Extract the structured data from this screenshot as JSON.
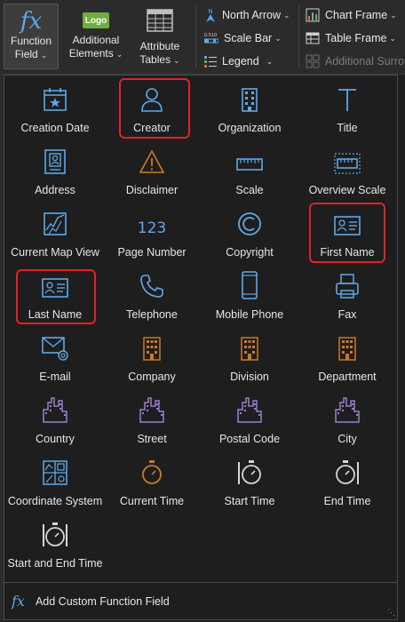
{
  "ribbon": {
    "function_field": {
      "icon": "fx",
      "label_line1": "Function",
      "label_line2": "Field"
    },
    "additional_elements": {
      "icon_text": "Logo",
      "label_line1": "Additional",
      "label_line2": "Elements"
    },
    "attribute_tables": {
      "label_line1": "Attribute",
      "label_line2": "Tables"
    },
    "north_arrow": "North Arrow",
    "scale_bar": "Scale Bar",
    "scale_bar_icon_text": "0.510",
    "legend": "Legend",
    "chart_frame": "Chart Frame",
    "table_frame": "Table Frame",
    "additional_surround": "Additional Surrou"
  },
  "gallery": {
    "items": [
      {
        "label": "Creation Date",
        "icon": "calendar-star-icon"
      },
      {
        "label": "Creator",
        "icon": "person-icon",
        "highlighted": true
      },
      {
        "label": "Organization",
        "icon": "building-icon"
      },
      {
        "label": "Title",
        "icon": "title-t-icon"
      },
      {
        "label": "Address",
        "icon": "address-card-icon"
      },
      {
        "label": "Disclaimer",
        "icon": "warning-triangle-icon"
      },
      {
        "label": "Scale",
        "icon": "ruler-icon"
      },
      {
        "label": "Overview Scale",
        "icon": "overview-ruler-icon"
      },
      {
        "label": "Current Map View",
        "icon": "map-view-icon"
      },
      {
        "label": "Page Number",
        "icon": "page-number-icon",
        "icon_text": "123"
      },
      {
        "label": "Copyright",
        "icon": "copyright-icon"
      },
      {
        "label": "First Name",
        "icon": "id-card-icon",
        "highlighted": true
      },
      {
        "label": "Last Name",
        "icon": "id-card-icon",
        "highlighted": true
      },
      {
        "label": "Telephone",
        "icon": "telephone-icon"
      },
      {
        "label": "Mobile Phone",
        "icon": "mobile-phone-icon"
      },
      {
        "label": "Fax",
        "icon": "fax-icon"
      },
      {
        "label": "E-mail",
        "icon": "email-icon"
      },
      {
        "label": "Company",
        "icon": "company-building-icon"
      },
      {
        "label": "Division",
        "icon": "division-building-icon"
      },
      {
        "label": "Department",
        "icon": "department-building-icon"
      },
      {
        "label": "Country",
        "icon": "country-skyline-icon"
      },
      {
        "label": "Street",
        "icon": "street-skyline-icon"
      },
      {
        "label": "Postal Code",
        "icon": "postal-skyline-icon"
      },
      {
        "label": "City",
        "icon": "city-skyline-icon"
      },
      {
        "label": "Coordinate System",
        "icon": "coordinate-grid-icon"
      },
      {
        "label": "Current Time",
        "icon": "stopwatch-icon"
      },
      {
        "label": "Start Time",
        "icon": "start-time-icon"
      },
      {
        "label": "End Time",
        "icon": "end-time-icon"
      },
      {
        "label": "Start and End Time",
        "icon": "start-end-time-icon"
      }
    ],
    "footer": {
      "icon": "fx",
      "label": "Add Custom Function Field"
    }
  },
  "colors": {
    "accent_blue": "#5fa8e8",
    "orange": "#c9782b",
    "purple": "#9b7fd0",
    "highlight_red": "#e0222a",
    "logo_green": "#6fae3c"
  }
}
